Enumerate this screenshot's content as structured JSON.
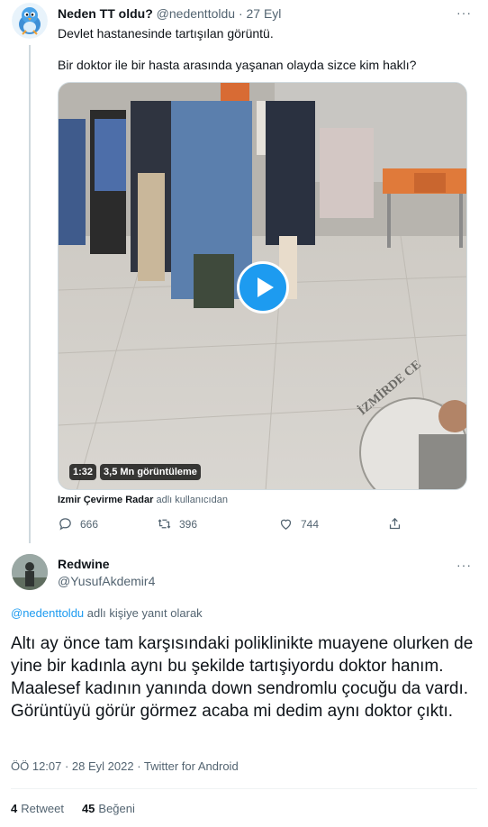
{
  "tweet": {
    "author_name": "Neden TT oldu?",
    "author_handle": "@nedenttoldu",
    "date": "· 27 Eyl",
    "more": "···",
    "text_line1": "Devlet hastanesinde tartışılan görüntü.",
    "text_line2": "Bir doktor ile bir hasta arasında yaşanan olayda sizce kim haklı?",
    "video": {
      "duration": "1:32",
      "views": "3,5 Mn görüntüleme",
      "watermark": "İZMİRDE CE"
    },
    "attribution_source": "Izmir Çevirme Radar",
    "attribution_suffix": "adlı kullanıcıdan",
    "actions": {
      "replies": "666",
      "retweets": "396",
      "likes": "744"
    }
  },
  "reply": {
    "author_name": "Redwine",
    "author_handle": "@YusufAkdemir4",
    "more": "···",
    "reply_to_handle": "@nedenttoldu",
    "reply_to_suffix": "adlı kişiye yanıt olarak",
    "text": "Altı ay önce tam karşısındaki poliklinikte muayene olurken de yine bir kadınla aynı bu şekilde tartışiyordu doktor hanım. Maalesef kadının yanında down sendromlu çocuğu da vardı. Görüntüyü görür görmez acaba mi dedim aynı doktor çıktı.",
    "meta": "ÖÖ 12:07 · 28 Eyl 2022 · Twitter for Android",
    "stats": {
      "retweets_count": "4",
      "retweets_label": "Retweet",
      "likes_count": "45",
      "likes_label": "Beğeni"
    }
  },
  "colors": {
    "accent": "#1d9bf0",
    "secondary_text": "#536471",
    "divider": "#eff3f4"
  }
}
